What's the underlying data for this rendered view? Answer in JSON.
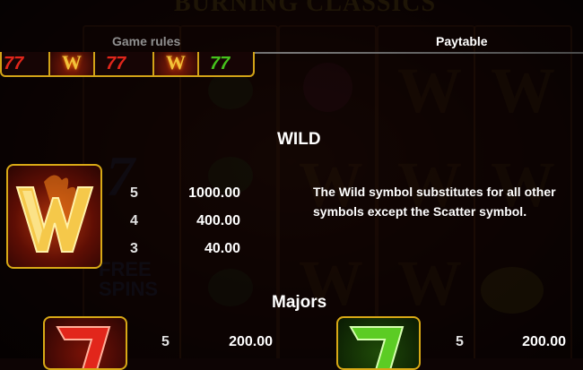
{
  "background": {
    "title": "BURNING CLASSICS"
  },
  "tabs": [
    {
      "label": "Game rules",
      "active": false
    },
    {
      "label": "Paytable",
      "active": true
    }
  ],
  "wild": {
    "title": "WILD",
    "icon": "wild-w-flame-icon",
    "payouts": [
      {
        "count": "5",
        "value": "1000.00"
      },
      {
        "count": "4",
        "value": "400.00"
      },
      {
        "count": "3",
        "value": "40.00"
      }
    ],
    "description": "The Wild symbol substitutes for all other symbols except the Scatter symbol."
  },
  "majors": {
    "title": "Majors",
    "items": [
      {
        "icon": "red-seven-icon",
        "count": "5",
        "value": "200.00"
      },
      {
        "icon": "green-seven-icon",
        "count": "5",
        "value": "200.00"
      }
    ]
  },
  "colors": {
    "gold": "#d8a916",
    "active_tab": "#ffffff",
    "inactive_tab": "#8f8f8f"
  }
}
